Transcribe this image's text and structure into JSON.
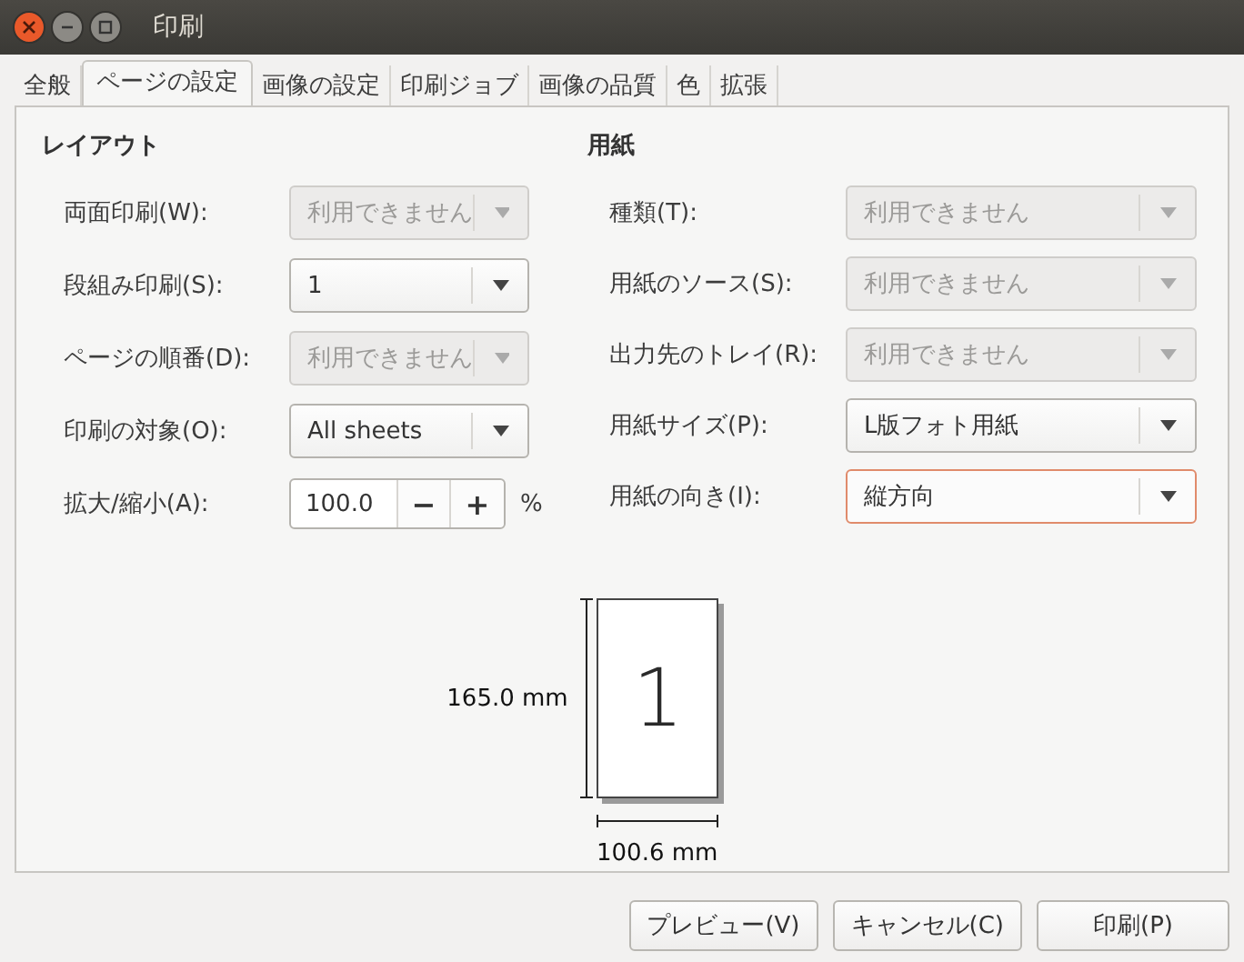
{
  "window": {
    "title": "印刷"
  },
  "tabs": [
    {
      "label": "全般",
      "selected": false
    },
    {
      "label": "ページの設定",
      "selected": true
    },
    {
      "label": "画像の設定",
      "selected": false
    },
    {
      "label": "印刷ジョブ",
      "selected": false
    },
    {
      "label": "画像の品質",
      "selected": false
    },
    {
      "label": "色",
      "selected": false
    },
    {
      "label": "拡張",
      "selected": false
    }
  ],
  "sections": [
    {
      "title": "レイアウト",
      "rows": [
        {
          "label": "両面印刷(W):",
          "kind": "combo",
          "value": "利用できません",
          "disabled": true,
          "focused": false
        },
        {
          "label": "段組み印刷(S):",
          "kind": "combo",
          "value": "1",
          "disabled": false,
          "focused": false
        },
        {
          "label": "ページの順番(D):",
          "kind": "combo",
          "value": "利用できません",
          "disabled": true,
          "focused": false
        },
        {
          "label": "印刷の対象(O):",
          "kind": "combo",
          "value": "All sheets",
          "disabled": false,
          "focused": false
        },
        {
          "label": "拡大/縮小(A):",
          "kind": "spin",
          "value": "100.0",
          "minus": "−",
          "plus": "+",
          "unit": "%"
        }
      ]
    },
    {
      "title": "用紙",
      "rows": [
        {
          "label": "種類(T):",
          "kind": "combo",
          "value": "利用できません",
          "disabled": true,
          "focused": false
        },
        {
          "label": "用紙のソース(S):",
          "kind": "combo",
          "value": "利用できません",
          "disabled": true,
          "focused": false
        },
        {
          "label": "出力先のトレイ(R):",
          "kind": "combo",
          "value": "利用できません",
          "disabled": true,
          "focused": false
        },
        {
          "label": "用紙サイズ(P):",
          "kind": "combo",
          "value": "L版フォト用紙",
          "disabled": false,
          "focused": false
        },
        {
          "label": "用紙の向き(I):",
          "kind": "combo",
          "value": "縦方向",
          "disabled": false,
          "focused": true
        }
      ]
    }
  ],
  "preview": {
    "page_number": "1",
    "height": "165.0 mm",
    "width": "100.6 mm"
  },
  "buttons": [
    "プレビュー(V)",
    "キャンセル(C)",
    "印刷(P)"
  ]
}
